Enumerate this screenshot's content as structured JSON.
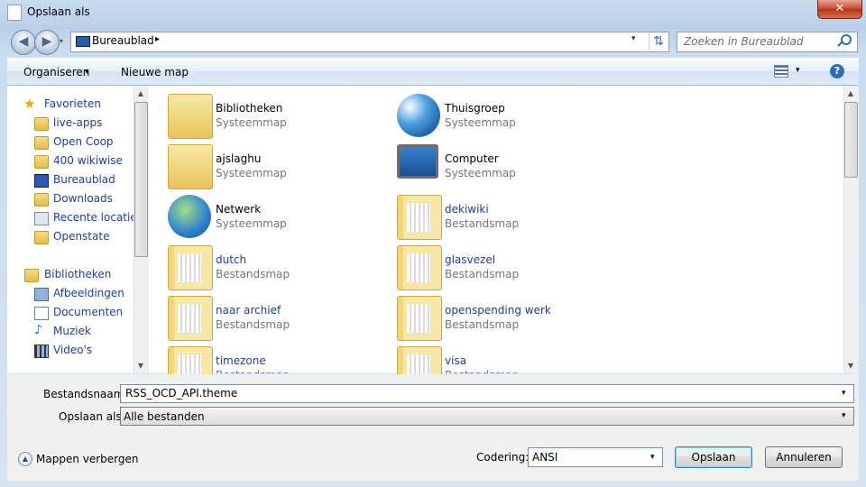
{
  "window": {
    "title": "Opslaan als",
    "close": "✕"
  },
  "nav": {
    "back": "◀",
    "forward": "▶",
    "dropdown": "▾"
  },
  "address": {
    "location": "Bureaublad",
    "arrow": "▸",
    "dropdown": "▾",
    "refresh": "⇅"
  },
  "search": {
    "placeholder": "Zoeken in Bureaublad"
  },
  "toolbar": {
    "organize": "Organiseren",
    "organize_drop": "▾",
    "new_folder": "Nieuwe map",
    "view_drop": "▾",
    "help": "?"
  },
  "sidebar": {
    "favorites": {
      "label": "Favorieten",
      "items": [
        "live-apps",
        "Open Coop",
        "400 wikiwise",
        "Bureaublad",
        "Downloads",
        "Recente locaties",
        "Openstate"
      ]
    },
    "libraries": {
      "label": "Bibliotheken",
      "items": [
        "Afbeeldingen",
        "Documenten",
        "Muziek",
        "Video's"
      ]
    }
  },
  "items": [
    {
      "name": "Bibliotheken",
      "type": "Systeemmap"
    },
    {
      "name": "Thuisgroep",
      "type": "Systeemmap"
    },
    {
      "name": "ajslaghu",
      "type": "Systeemmap"
    },
    {
      "name": "Computer",
      "type": "Systeemmap"
    },
    {
      "name": "Netwerk",
      "type": "Systeemmap"
    },
    {
      "name": "dekiwiki",
      "type": "Bestandsmap"
    },
    {
      "name": "dutch",
      "type": "Bestandsmap"
    },
    {
      "name": "glasvezel",
      "type": "Bestandsmap"
    },
    {
      "name": "naar archief",
      "type": "Bestandsmap"
    },
    {
      "name": "openspending werk",
      "type": "Bestandsmap"
    },
    {
      "name": "timezone",
      "type": "Bestandsmap"
    },
    {
      "name": "visa",
      "type": "Bestandsmap"
    }
  ],
  "form": {
    "filename_label": "Bestandsnaam:",
    "filename_value": "RSS_OCD_API.theme",
    "savetype_label": "Opslaan als:",
    "savetype_value": "Alle bestanden",
    "dropdown": "▾"
  },
  "footer": {
    "hide_folders": "Mappen verbergen",
    "hide_icon": "▲",
    "encoding_label": "Codering:",
    "encoding_value": "ANSI",
    "save": "Opslaan",
    "cancel": "Annuleren"
  },
  "scroll": {
    "up": "▲",
    "down": "▼"
  }
}
